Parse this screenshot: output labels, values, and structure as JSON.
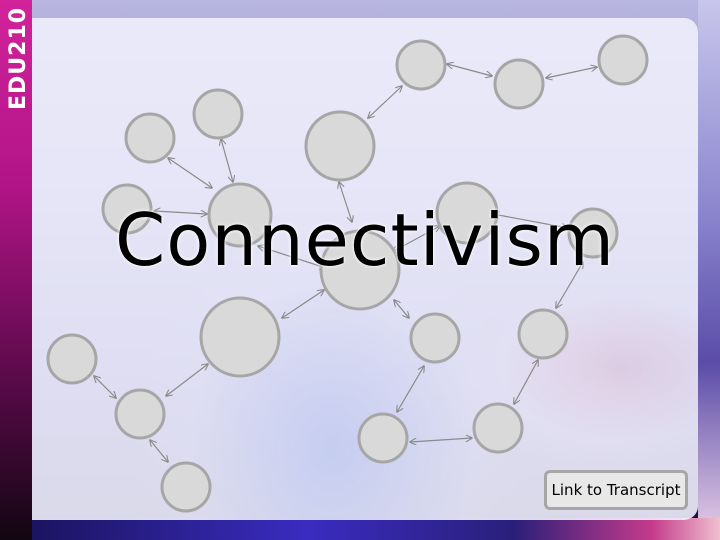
{
  "course_code": "EDU210",
  "slide": {
    "title": "Connectivism"
  },
  "transcript_link": {
    "label": "Link to Transcript"
  },
  "network_style": {
    "node_fill": "#d9d9d9",
    "node_stroke": "#a6a6a6",
    "link_color": "#8a8a8a"
  }
}
